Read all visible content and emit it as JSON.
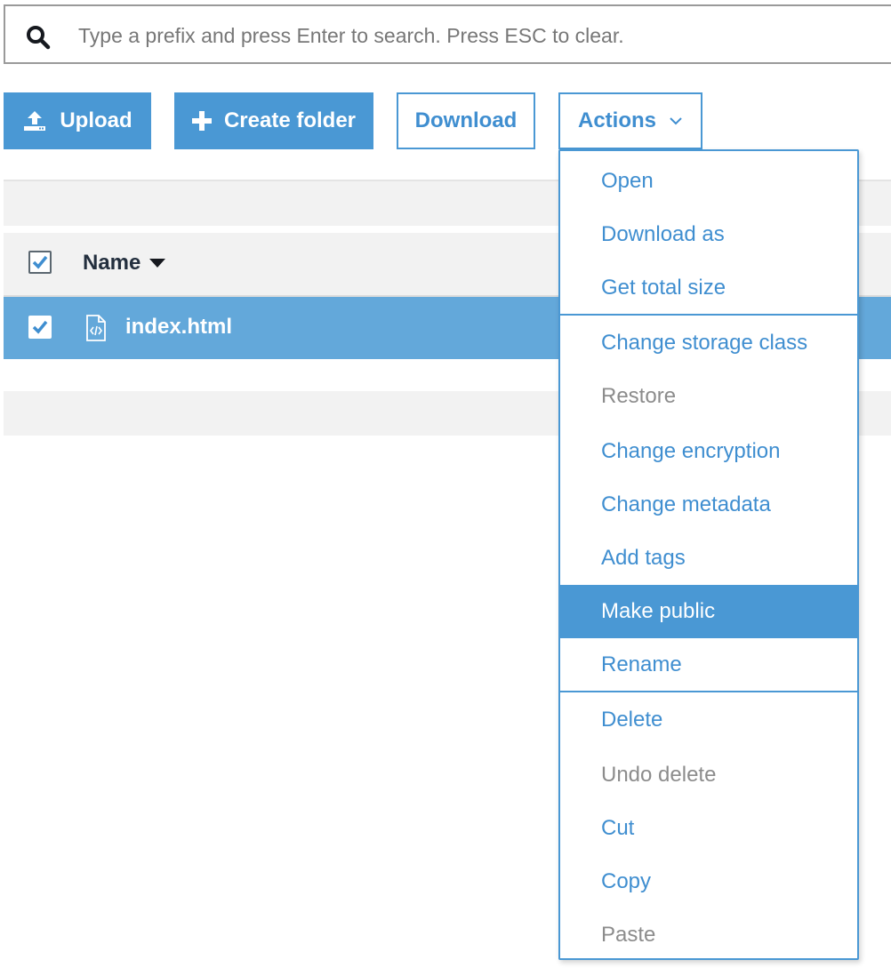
{
  "search": {
    "placeholder": "Type a prefix and press Enter to search. Press ESC to clear."
  },
  "toolbar": {
    "upload_label": "Upload",
    "create_folder_label": "Create folder",
    "download_label": "Download",
    "actions_label": "Actions"
  },
  "table": {
    "name_column": "Name",
    "rows": [
      {
        "name": "index.html",
        "selected": true
      }
    ]
  },
  "actions_menu": {
    "items": [
      {
        "label": "Open",
        "enabled": true
      },
      {
        "label": "Download as",
        "enabled": true
      },
      {
        "label": "Get total size",
        "enabled": true
      },
      {
        "label": "Change storage class",
        "enabled": true
      },
      {
        "label": "Restore",
        "enabled": false
      },
      {
        "label": "Change encryption",
        "enabled": true
      },
      {
        "label": "Change metadata",
        "enabled": true
      },
      {
        "label": "Add tags",
        "enabled": true
      },
      {
        "label": "Make public",
        "enabled": true,
        "highlighted": true
      },
      {
        "label": "Rename",
        "enabled": true
      },
      {
        "label": "Delete",
        "enabled": true
      },
      {
        "label": "Undo delete",
        "enabled": false
      },
      {
        "label": "Cut",
        "enabled": true
      },
      {
        "label": "Copy",
        "enabled": true
      },
      {
        "label": "Paste",
        "enabled": false
      }
    ]
  },
  "colors": {
    "accent": "#4a98d4",
    "selected_row": "#63a8da",
    "disabled_text": "#8c8c8c"
  }
}
